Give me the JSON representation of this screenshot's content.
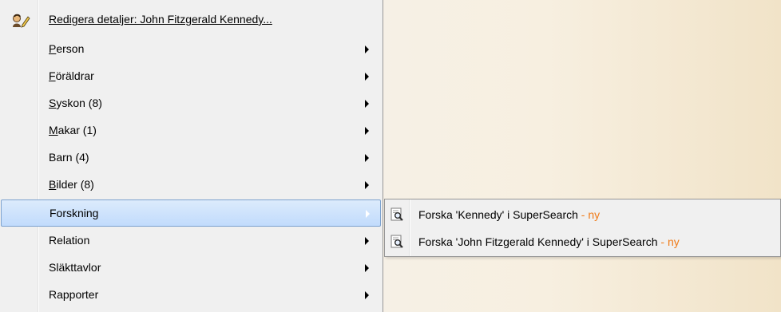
{
  "menu": {
    "header": {
      "label": "Redigera detaljer: John Fitzgerald Kennedy...",
      "icon": "edit-person-icon"
    },
    "items": [
      {
        "label": "Person",
        "underline": "P",
        "rest": "erson"
      },
      {
        "label": "Föräldrar",
        "underline": "F",
        "rest": "öräldrar"
      },
      {
        "label": "Syskon (8)",
        "underline": "S",
        "rest": "yskon (8)"
      },
      {
        "label": "Makar (1)",
        "underline": "M",
        "rest": "akar (1)"
      },
      {
        "label": "Barn (4)",
        "underline": "",
        "rest": "Barn (4)"
      },
      {
        "label": "Bilder (8)",
        "underline": "B",
        "rest": "ilder (8)"
      },
      {
        "label": "Forskning",
        "underline": "",
        "rest": "Forskning"
      },
      {
        "label": "Relation",
        "underline": "",
        "rest": "Relation"
      },
      {
        "label": "Släkttavlor",
        "underline": "",
        "rest": "Släkttavlor"
      },
      {
        "label": "Rapporter",
        "underline": "",
        "rest": "Rapporter"
      }
    ],
    "highlight_color": "#c1dbfc"
  },
  "submenu": {
    "items": [
      {
        "text": "Forska 'Kennedy' i SuperSearch",
        "new": " - ny",
        "icon": "search-document-icon"
      },
      {
        "text": "Forska 'John Fitzgerald Kennedy' i SuperSearch",
        "new": " - ny",
        "icon": "search-document-icon"
      }
    ],
    "new_color": "#f07b18"
  }
}
